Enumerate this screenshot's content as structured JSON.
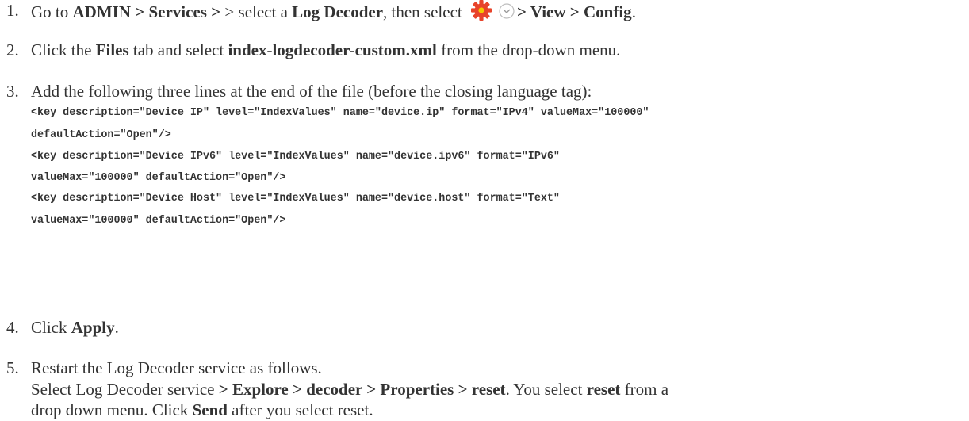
{
  "steps": [
    {
      "number": "1.",
      "parts": {
        "t1": "Go to ",
        "b1": "ADMIN",
        "t2": " > ",
        "b2": "Services",
        "t3": " > select a ",
        "b3": "Log Decoder",
        "t4": ", then select ",
        "b4": "> View > Config",
        "t5": "."
      },
      "icons": [
        "gear-icon",
        "chevron-down-icon"
      ]
    },
    {
      "number": "2.",
      "parts": {
        "t1": "Click the ",
        "b1": "Files",
        "t2": " tab and select ",
        "b2": "index-logdecoder-custom.xml",
        "t3": " from the drop-down menu."
      }
    },
    {
      "number": "3.",
      "text": "Add the following three lines at the end of the file (before the closing language tag):",
      "code_lines": [
        "<key description=\"Device IP\" level=\"IndexValues\" name=\"device.ip\" format=\"IPv4\" valueMax=\"100000\"",
        "defaultAction=\"Open\"/>",
        "<key description=\"Device IPv6\" level=\"IndexValues\" name=\"device.ipv6\" format=\"IPv6\"",
        "valueMax=\"100000\" defaultAction=\"Open\"/>",
        "<key description=\"Device Host\" level=\"IndexValues\" name=\"device.host\" format=\"Text\"",
        "valueMax=\"100000\" defaultAction=\"Open\"/>"
      ]
    },
    {
      "number": "4.",
      "parts": {
        "t1": "Click ",
        "b1": "Apply",
        "t2": "."
      }
    },
    {
      "number": "5.",
      "text": "Restart the Log Decoder service as follows.",
      "line2": {
        "t1": "Select Log Decoder service ",
        "b1": "> Explore > decoder > Properties > reset",
        "t2": ". You select ",
        "b2": "reset",
        "t3": " from a"
      },
      "line3": {
        "t1": "drop down menu. Click ",
        "b1": "Send",
        "t2": " after you select reset."
      }
    }
  ],
  "colors": {
    "text": "#333333",
    "gear": "#e8432a",
    "gear_center": "#f5c800"
  }
}
